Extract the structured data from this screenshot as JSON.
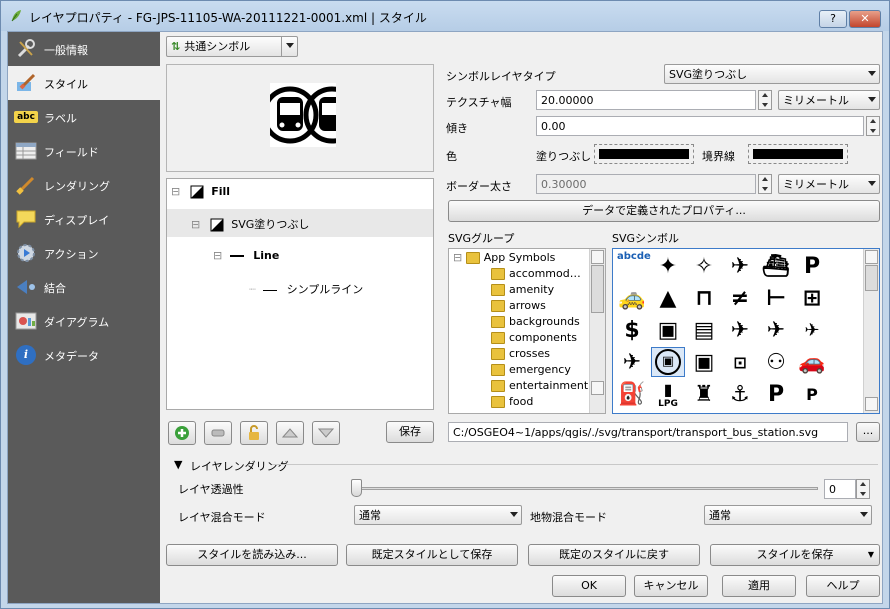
{
  "window": {
    "title": "レイヤプロパティ - FG-JPS-11105-WA-20111221-0001.xml | スタイル",
    "help_btn": "?",
    "close_btn": "✕"
  },
  "sidebar": {
    "items": [
      {
        "label": "一般情報",
        "icon": "wrench-icon"
      },
      {
        "label": "スタイル",
        "icon": "paintbrush-icon"
      },
      {
        "label": "ラベル",
        "icon": "abc-label-icon",
        "icon_text": "abc"
      },
      {
        "label": "フィールド",
        "icon": "table-icon"
      },
      {
        "label": "レンダリング",
        "icon": "brush-icon"
      },
      {
        "label": "ディスプレイ",
        "icon": "speech-bubble-icon"
      },
      {
        "label": "アクション",
        "icon": "gear-play-icon"
      },
      {
        "label": "結合",
        "icon": "join-icon"
      },
      {
        "label": "ダイアグラム",
        "icon": "diagram-icon"
      },
      {
        "label": "メタデータ",
        "icon": "info-icon",
        "icon_text": "i"
      }
    ]
  },
  "style": {
    "renderer_combo": "共通シンボル",
    "tree": {
      "fill": "Fill",
      "svg_fill": "SVG塗りつぶし",
      "line": "Line",
      "simple_line": "シンプルライン"
    },
    "save_btn": "保存"
  },
  "props": {
    "symbol_layer_type_label": "シンボルレイヤタイプ",
    "symbol_layer_type": "SVG塗りつぶし",
    "texture_width_label": "テクスチャ幅",
    "texture_width": "20.00000",
    "texture_unit": "ミリメートル",
    "rotation_label": "傾き",
    "rotation": "0.00",
    "color_label": "色",
    "fill_label": "塗りつぶし",
    "border_label": "境界線",
    "border_width_label": "ボーダー太さ",
    "border_width": "0.30000",
    "border_unit": "ミリメートル",
    "data_defined_btn": "データで定義されたプロパティ..."
  },
  "svg_groups": {
    "label": "SVGグループ",
    "root": "App Symbols",
    "items": [
      "accommod…",
      "amenity",
      "arrows",
      "backgrounds",
      "components",
      "crosses",
      "emergency",
      "entertainment",
      "food"
    ]
  },
  "svg_symbols": {
    "label": "SVGシンボル",
    "first_cell_text": "abcde",
    "path": "C:/OSGEO4~1/apps/qgis/./svg/transport/transport_bus_station.svg",
    "browse_btn": "..."
  },
  "layer_rendering": {
    "header": "レイヤレンダリング",
    "transparency_label": "レイヤ透過性",
    "transparency_value": "0",
    "transparency_level": 0,
    "blend_label": "レイヤ混合モード",
    "blend_value": "通常",
    "feature_blend_label": "地物混合モード",
    "feature_blend_value": "通常"
  },
  "bottom": {
    "load_style": "スタイルを読み込み...",
    "save_default": "既定スタイルとして保存",
    "restore_default": "既定のスタイルに戻す",
    "save_style": "スタイルを保存",
    "ok": "OK",
    "cancel": "キャンセル",
    "apply": "適用",
    "help": "ヘルプ"
  }
}
